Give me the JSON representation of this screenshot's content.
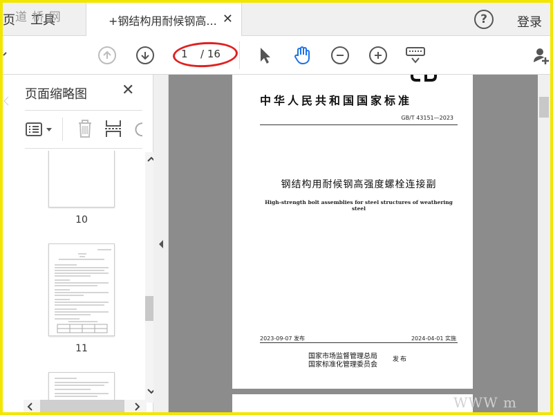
{
  "tabs": {
    "home_label": "页",
    "tools_label": "工具",
    "doc_label": "+钢结构用耐候钢高...",
    "close_glyph": "✕"
  },
  "watermark": "道 桥 网",
  "header": {
    "help_glyph": "?",
    "login_label": "登录"
  },
  "toolbar": {
    "current_page": "1",
    "total_pages": "/ 16",
    "icons": [
      "arrow-up-icon",
      "arrow-down-icon",
      "select-cursor-icon",
      "hand-tool-icon",
      "zoom-out-icon",
      "zoom-in-icon",
      "keyboard-icon",
      "add-user-icon"
    ]
  },
  "sidebar": {
    "title": "页面缩略图",
    "close_glyph": "✕",
    "thumbnails": [
      {
        "label": "10"
      },
      {
        "label": "11"
      }
    ]
  },
  "document": {
    "logo_text": "GB",
    "standard_title": "中华人民共和国国家标准",
    "code": "GB/T 43151—2023",
    "cn_title": "钢结构用耐候钢高强度螺栓连接副",
    "en_title": "High-strength bolt assemblies for steel structures of weathering steel",
    "pub_date": "2023-09-07 发布",
    "impl_date": "2024-04-01 实施",
    "issuer1": "国家市场监督管理总局",
    "issuer2": "国家标准化管理委员会",
    "issue_word": "发布"
  },
  "bottom_mark": "WWW                 m",
  "colors": {
    "frame": "#f2e600",
    "annotation_red": "#e02020",
    "accent_blue": "#1a73e8",
    "doc_bg": "#8c8c8c"
  }
}
